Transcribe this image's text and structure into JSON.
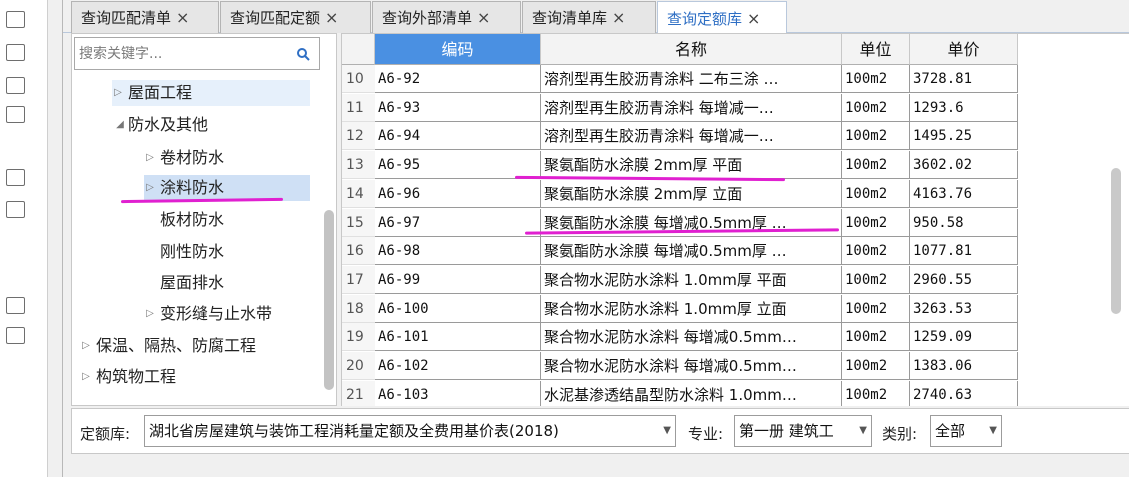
{
  "tabs": [
    {
      "label": "查询匹配清单",
      "active": false
    },
    {
      "label": "查询匹配定额",
      "active": false
    },
    {
      "label": "查询外部清单",
      "active": false
    },
    {
      "label": "查询清单库",
      "active": false
    },
    {
      "label": "查询定额库",
      "active": true
    }
  ],
  "tab_close_glyph": "×",
  "tree": {
    "search_placeholder": "搜索关键字...",
    "nodes": [
      {
        "label": "屋面工程",
        "expanded": false
      },
      {
        "label": "防水及其他",
        "expanded": true
      },
      {
        "label": "卷材防水",
        "expanded": false
      },
      {
        "label": "涂料防水",
        "expanded": false,
        "selected": true
      },
      {
        "label": "板材防水"
      },
      {
        "label": "刚性防水"
      },
      {
        "label": "屋面排水"
      },
      {
        "label": "变形缝与止水带",
        "expanded": false
      },
      {
        "label": "保温、隔热、防腐工程",
        "expanded": false
      },
      {
        "label": "构筑物工程",
        "expanded": false
      }
    ]
  },
  "grid": {
    "columns": [
      "编码",
      "名称",
      "单位",
      "单价"
    ],
    "rows": [
      {
        "num": "10",
        "code": "A6-92",
        "name": "溶剂型再生胶沥青涂料 二布三涂 …",
        "unit": "100m2",
        "price": "3728.81"
      },
      {
        "num": "11",
        "code": "A6-93",
        "name": "溶剂型再生胶沥青涂料 每增减一…",
        "unit": "100m2",
        "price": "1293.6"
      },
      {
        "num": "12",
        "code": "A6-94",
        "name": "溶剂型再生胶沥青涂料 每增减一…",
        "unit": "100m2",
        "price": "1495.25"
      },
      {
        "num": "13",
        "code": "A6-95",
        "name": "聚氨酯防水涂膜 2mm厚 平面",
        "unit": "100m2",
        "price": "3602.02"
      },
      {
        "num": "14",
        "code": "A6-96",
        "name": "聚氨酯防水涂膜 2mm厚 立面",
        "unit": "100m2",
        "price": "4163.76"
      },
      {
        "num": "15",
        "code": "A6-97",
        "name": "聚氨酯防水涂膜 每增减0.5mm厚 …",
        "unit": "100m2",
        "price": "950.58"
      },
      {
        "num": "16",
        "code": "A6-98",
        "name": "聚氨酯防水涂膜 每增减0.5mm厚 …",
        "unit": "100m2",
        "price": "1077.81"
      },
      {
        "num": "17",
        "code": "A6-99",
        "name": "聚合物水泥防水涂料 1.0mm厚 平面",
        "unit": "100m2",
        "price": "2960.55"
      },
      {
        "num": "18",
        "code": "A6-100",
        "name": "聚合物水泥防水涂料 1.0mm厚 立面",
        "unit": "100m2",
        "price": "3263.53"
      },
      {
        "num": "19",
        "code": "A6-101",
        "name": "聚合物水泥防水涂料 每增减0.5mm…",
        "unit": "100m2",
        "price": "1259.09"
      },
      {
        "num": "20",
        "code": "A6-102",
        "name": "聚合物水泥防水涂料 每增减0.5mm…",
        "unit": "100m2",
        "price": "1383.06"
      },
      {
        "num": "21",
        "code": "A6-103",
        "name": "水泥基渗透结晶型防水涂料 1.0mm…",
        "unit": "100m2",
        "price": "2740.63"
      }
    ]
  },
  "filters": {
    "library_label": "定额库:",
    "library_value": "湖北省房屋建筑与装饰工程消耗量定额及全费用基价表(2018)",
    "major_label": "专业:",
    "major_value": "第一册 建筑工",
    "category_label": "类别:",
    "category_value": "全部"
  },
  "colors": {
    "accent": "#4a90e2",
    "active_tab_text": "#2f6fc4",
    "annotation": "#e020d0"
  },
  "icons": {
    "search": "search-icon",
    "expand": "triangle-right-icon",
    "collapse": "triangle-down-icon",
    "dropdown": "caret-down-icon"
  }
}
